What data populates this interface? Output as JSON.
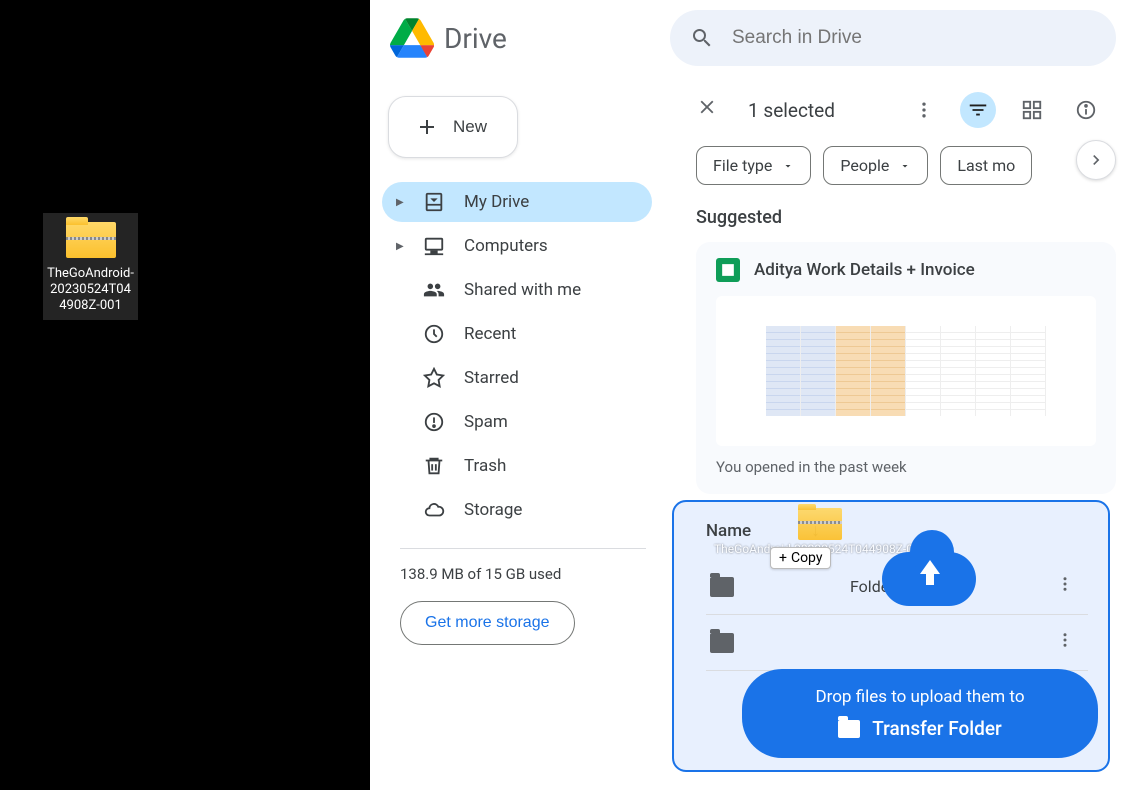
{
  "desktop": {
    "file_label": "TheGoAndroid-20230524T044908Z-001"
  },
  "drive": {
    "title": "Drive"
  },
  "search": {
    "placeholder": "Search in Drive"
  },
  "sidebar": {
    "new_label": "New",
    "items": [
      {
        "label": "My Drive",
        "icon": "drive",
        "selected": true,
        "expandable": true
      },
      {
        "label": "Computers",
        "icon": "computers",
        "selected": false,
        "expandable": true
      },
      {
        "label": "Shared with me",
        "icon": "shared",
        "selected": false,
        "expandable": false
      },
      {
        "label": "Recent",
        "icon": "recent",
        "selected": false,
        "expandable": false
      },
      {
        "label": "Starred",
        "icon": "starred",
        "selected": false,
        "expandable": false
      },
      {
        "label": "Spam",
        "icon": "spam",
        "selected": false,
        "expandable": false
      },
      {
        "label": "Trash",
        "icon": "trash",
        "selected": false,
        "expandable": false
      },
      {
        "label": "Storage",
        "icon": "storage",
        "selected": false,
        "expandable": false
      }
    ],
    "storage_usage": "138.9 MB of 15 GB used",
    "storage_button": "Get more storage"
  },
  "toolbar": {
    "selected_text": "1 selected"
  },
  "filters": {
    "chips": [
      "File type",
      "People",
      "Last mo"
    ]
  },
  "suggested": {
    "heading": "Suggested",
    "card_title": "Aditya Work Details + Invoice",
    "card_subtitle": "You opened in the past week"
  },
  "table": {
    "name_header": "Name",
    "sort_direction": "↓",
    "rows": [
      {
        "label": "Folde"
      },
      {
        "label": ""
      }
    ]
  },
  "drag": {
    "ghost_label": "TheGoAndroid-20230524T044908Z-001",
    "copy_label": "Copy"
  },
  "drop_banner": {
    "line1": "Drop files to upload them to",
    "folder": "Transfer Folder"
  }
}
